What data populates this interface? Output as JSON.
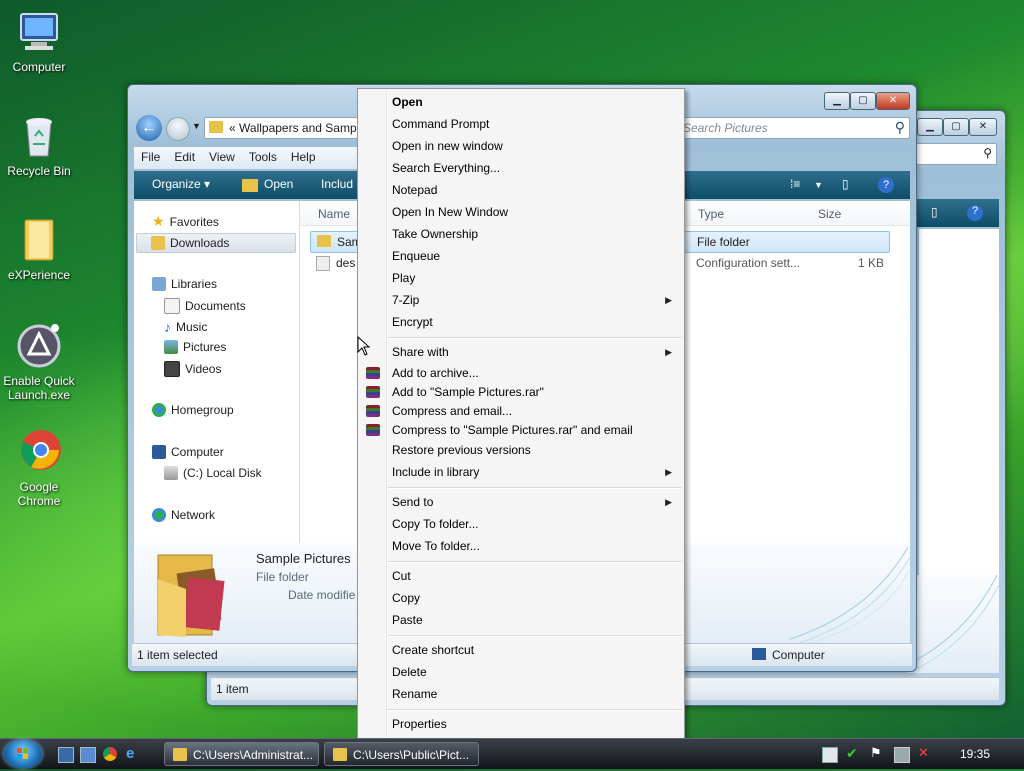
{
  "desktop": {
    "icons": [
      {
        "label": "Computer"
      },
      {
        "label": "Recycle Bin"
      },
      {
        "label": "eXPerience"
      },
      {
        "label": "Enable Quick Launch.exe"
      },
      {
        "label": "Google Chrome"
      }
    ]
  },
  "front_window": {
    "address_crumbs": "«  Wallpapers and Samp",
    "search_placeholder": "Search Pictures",
    "menu": [
      "File",
      "Edit",
      "View",
      "Tools",
      "Help"
    ],
    "toolbar": {
      "organize": "Organize ▾",
      "open": "Open",
      "include": "Includ"
    },
    "nav": {
      "favorites": "Favorites",
      "downloads": "Downloads",
      "libraries": "Libraries",
      "documents": "Documents",
      "music": "Music",
      "pictures": "Pictures",
      "videos": "Videos",
      "homegroup": "Homegroup",
      "computer": "Computer",
      "local_disk": "(C:) Local Disk",
      "network": "Network"
    },
    "columns": {
      "name": "Name",
      "type": "Type",
      "size": "Size"
    },
    "rows": [
      {
        "name": "Sam",
        "type": "File folder",
        "size": ""
      },
      {
        "name": "des",
        "type": "Configuration sett...",
        "size": "1 KB"
      }
    ],
    "details": {
      "title": "Sample Pictures",
      "kind": "File folder",
      "date_label": "Date modifie"
    },
    "status": {
      "left": "1 item selected",
      "right": "Computer"
    }
  },
  "back_window": {
    "status": "1 item"
  },
  "context_menu": {
    "groups": [
      [
        "Open",
        "Command Prompt",
        "Open in new window",
        "Search Everything...",
        "Notepad",
        "Open In New Window",
        "Take Ownership",
        "Enqueue",
        "Play",
        "7-Zip",
        "Encrypt"
      ],
      [
        "Share with",
        "Add to archive...",
        "Add to \"Sample Pictures.rar\"",
        "Compress and email...",
        "Compress to \"Sample Pictures.rar\" and email",
        "Restore previous versions",
        "Include in library"
      ],
      [
        "Send to",
        "Copy To folder...",
        "Move To folder..."
      ],
      [
        "Cut",
        "Copy",
        "Paste"
      ],
      [
        "Create shortcut",
        "Delete",
        "Rename"
      ],
      [
        "Properties"
      ]
    ]
  },
  "taskbar": {
    "tasks": [
      "C:\\Users\\Administrat...",
      "C:\\Users\\Public\\Pict..."
    ],
    "clock": "19:35"
  }
}
